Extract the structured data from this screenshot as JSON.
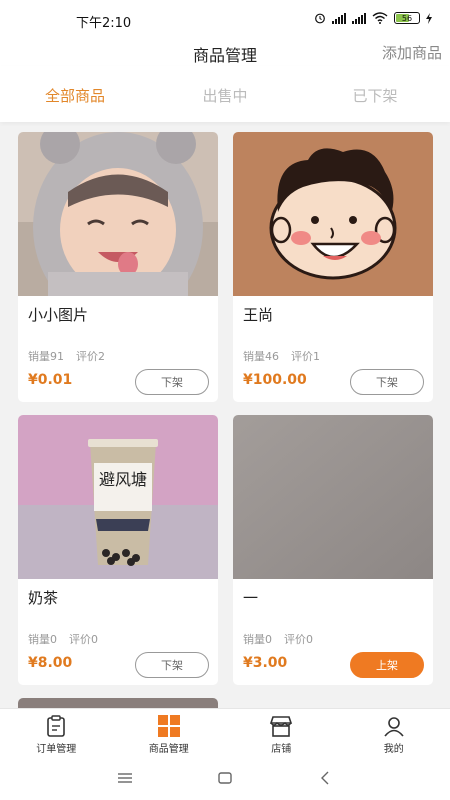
{
  "status_bar": {
    "time": "下午2:10",
    "battery": "56"
  },
  "nav": {
    "title": "商品管理",
    "action": "添加商品"
  },
  "tabs": [
    {
      "label": "全部商品",
      "active": true
    },
    {
      "label": "出售中",
      "active": false
    },
    {
      "label": "已下架",
      "active": false
    }
  ],
  "products": [
    {
      "name": "小小图片",
      "sales": "销量91",
      "reviews": "评价2",
      "price": "¥0.01",
      "action": "下架",
      "image": "baby-photo"
    },
    {
      "name": "王尚",
      "sales": "销量46",
      "reviews": "评价1",
      "price": "¥100.00",
      "action": "下架",
      "image": "cartoon-face"
    },
    {
      "name": "奶茶",
      "sales": "销量0",
      "reviews": "评价0",
      "price": "¥8.00",
      "action": "下架",
      "image": "milk-tea-photo",
      "image_text": "避风塘"
    },
    {
      "name": "一",
      "sales": "销量0",
      "reviews": "评价0",
      "price": "¥3.00",
      "action": "上架",
      "image": "gray-photo"
    }
  ],
  "bottom_nav": [
    {
      "label": "订单管理",
      "icon": "order-icon"
    },
    {
      "label": "商品管理",
      "icon": "grid-icon",
      "active": true
    },
    {
      "label": "店铺",
      "icon": "store-icon"
    },
    {
      "label": "我的",
      "icon": "user-icon"
    }
  ],
  "colors": {
    "accent": "#e2872a",
    "primary_button": "#ef7a22",
    "price": "#e07a1f"
  }
}
